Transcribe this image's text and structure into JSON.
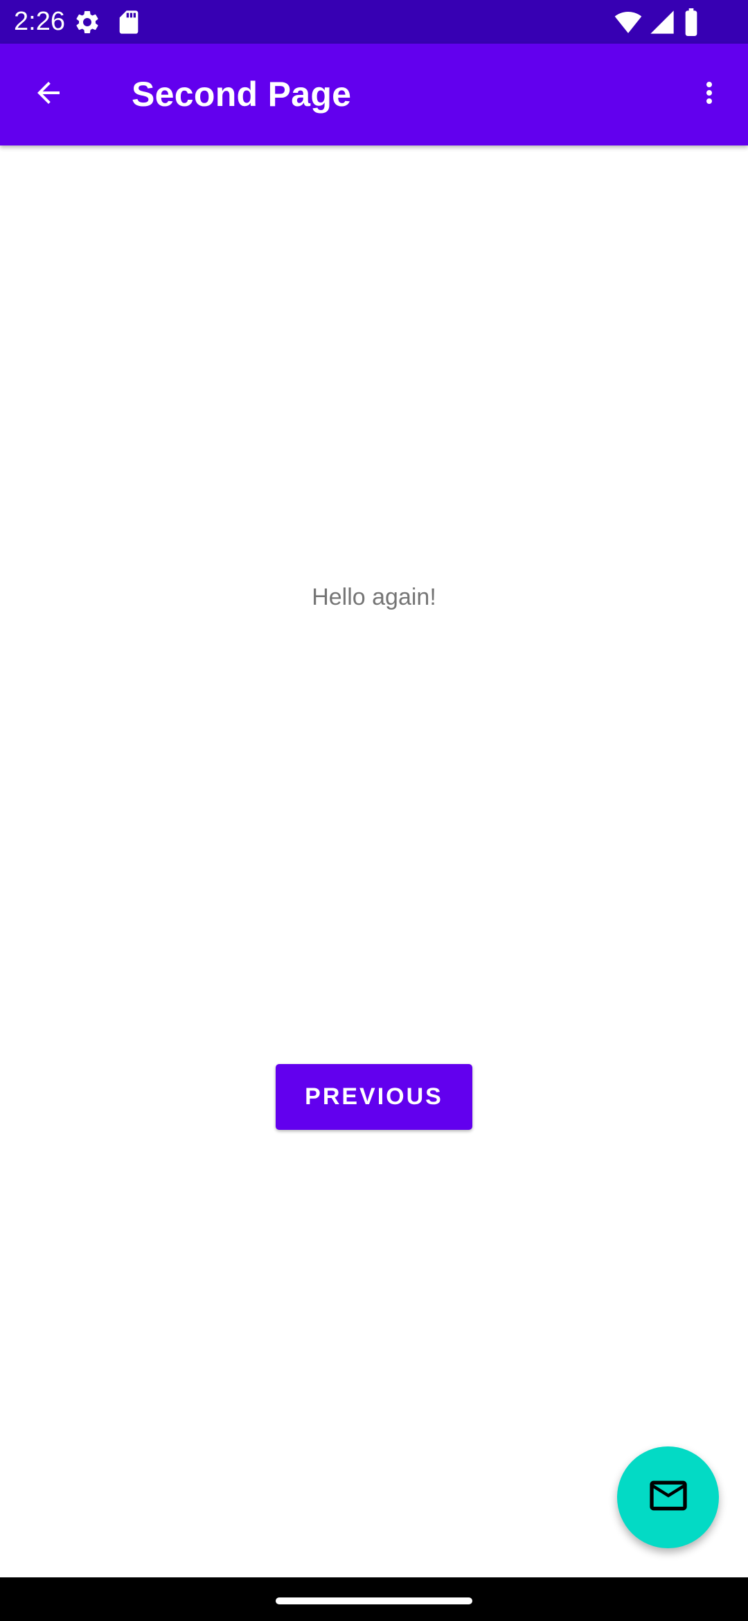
{
  "status_bar": {
    "time": "2:26",
    "background_color": "#3700b3",
    "icons": [
      "settings-gear-icon",
      "sd-card-icon",
      "wifi-icon",
      "cellular-signal-icon",
      "battery-icon"
    ]
  },
  "app_bar": {
    "title": "Second Page",
    "background_color": "#6200ee",
    "back_icon": "arrow-back-icon",
    "overflow_icon": "more-vert-icon"
  },
  "content": {
    "message": "Hello again!",
    "previous_button_label": "PREVIOUS"
  },
  "fab": {
    "icon": "email-icon",
    "color": "#03dac5"
  },
  "nav_bar": {
    "handle": "gesture-handle"
  }
}
